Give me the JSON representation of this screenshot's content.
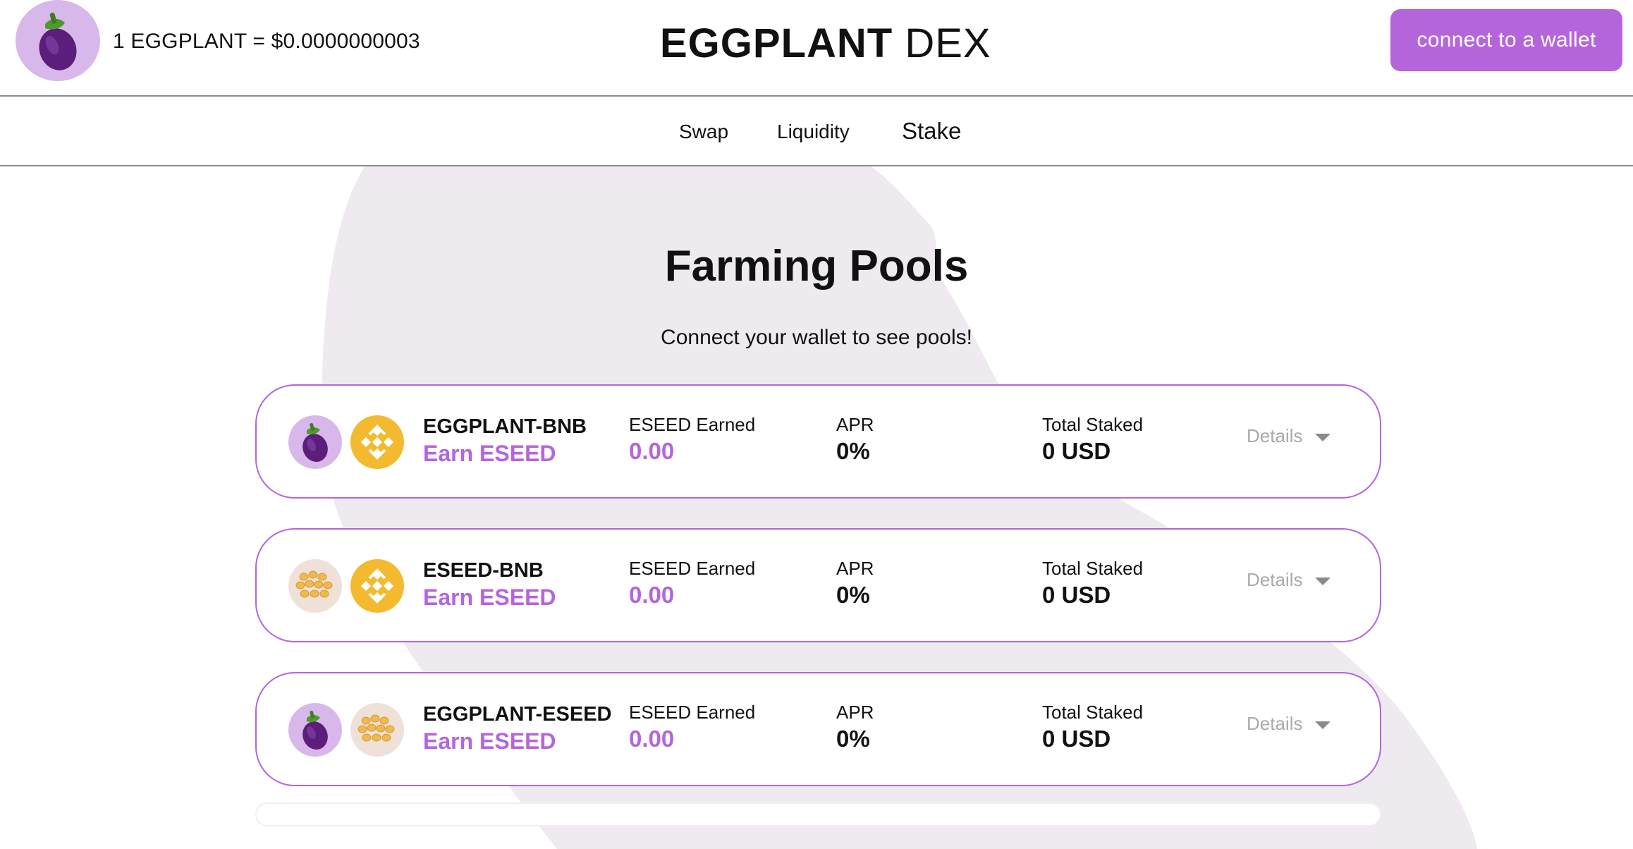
{
  "header": {
    "logo_icon": "eggplant-icon",
    "price_text": "1 EGGPLANT = $0.0000000003",
    "brand_bold": "EGGPLANT",
    "brand_light": " DEX",
    "connect_label": "connect to a wallet"
  },
  "nav": {
    "items": [
      {
        "label": "Swap"
      },
      {
        "label": "Liquidity"
      },
      {
        "label": "Stake"
      }
    ]
  },
  "main": {
    "title": "Farming Pools",
    "subtitle": "Connect your wallet to see pools!"
  },
  "pools": [
    {
      "name": "EGGPLANT-BNB",
      "earn": "Earn ESEED",
      "token1_icon": "eggplant-icon",
      "token2_icon": "bnb-icon",
      "earned_label": "ESEED Earned",
      "earned_value": "0.00",
      "apr_label": "APR",
      "apr_value": "0%",
      "staked_label": "Total Staked",
      "staked_value": "0 USD",
      "details_label": "Details"
    },
    {
      "name": "ESEED-BNB",
      "earn": "Earn ESEED",
      "token1_icon": "seeds-icon",
      "token2_icon": "bnb-icon",
      "earned_label": "ESEED Earned",
      "earned_value": "0.00",
      "apr_label": "APR",
      "apr_value": "0%",
      "staked_label": "Total Staked",
      "staked_value": "0 USD",
      "details_label": "Details"
    },
    {
      "name": "EGGPLANT-ESEED",
      "earn": "Earn ESEED",
      "token1_icon": "eggplant-icon",
      "token2_icon": "seeds-icon",
      "earned_label": "ESEED Earned",
      "earned_value": "0.00",
      "apr_label": "APR",
      "apr_value": "0%",
      "staked_label": "Total Staked",
      "staked_value": "0 USD",
      "details_label": "Details"
    }
  ],
  "colors": {
    "accent": "#b565dc",
    "accent_light": "#d8b8ea",
    "bnb": "#f3ba2f",
    "seed_bg": "#efe1d8",
    "bg_shape": "#eeeaf0"
  }
}
